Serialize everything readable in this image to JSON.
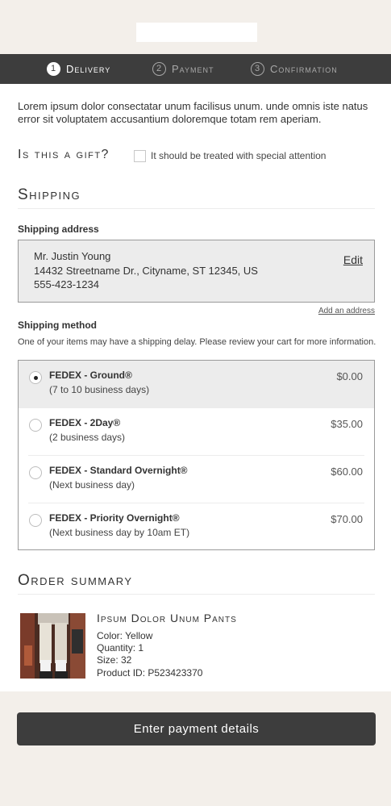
{
  "progress": {
    "steps": [
      {
        "num": "1",
        "label": "Delivery"
      },
      {
        "num": "2",
        "label": "Payment"
      },
      {
        "num": "3",
        "label": "Confirmation"
      }
    ],
    "active_step": 1
  },
  "intro_text": "Lorem ipsum dolor consectatar unum facilisus unum. unde omnis iste natus error sit voluptatem accusantium doloremque  totam rem aperiam.",
  "gift": {
    "title": "Is this a gift?",
    "checkbox_label": "It should be treated with special attention",
    "checked": false
  },
  "shipping": {
    "title": "Shipping",
    "address_label": "Shipping address",
    "address": {
      "name": "Mr. Justin Young",
      "street": "14432 Streetname Dr., Cityname, ST 12345, US",
      "phone": "555-423-1234"
    },
    "edit_label": "Edit",
    "add_address_label": "Add an address",
    "method_label": "Shipping method",
    "method_note": "One of your items may have a shipping delay. Please review your cart for more information.",
    "methods": [
      {
        "name": "FEDEX - Ground®",
        "detail": "(7 to 10 business days)",
        "price": "$0.00",
        "selected": true
      },
      {
        "name": "FEDEX - 2Day®",
        "detail": "(2 business days)",
        "price": "$35.00",
        "selected": false
      },
      {
        "name": "FEDEX - Standard Overnight®",
        "detail": "(Next business day)",
        "price": "$60.00",
        "selected": false
      },
      {
        "name": "FEDEX - Priority Overnight®",
        "detail": "(Next business day by 10am ET)",
        "price": "$70.00",
        "selected": false
      }
    ]
  },
  "order_summary": {
    "title": "Order summary",
    "product": {
      "name": "Ipsum Dolor Unum Pants",
      "color": "Color: Yellow",
      "quantity": "Quantity: 1",
      "size": "Size: 32",
      "product_id": "Product ID: P523423370"
    }
  },
  "cta": {
    "label": "Enter payment details"
  },
  "colors": {
    "dark": "#3d3d3d",
    "band": "#f3efea",
    "selected_bg": "#ececec"
  }
}
